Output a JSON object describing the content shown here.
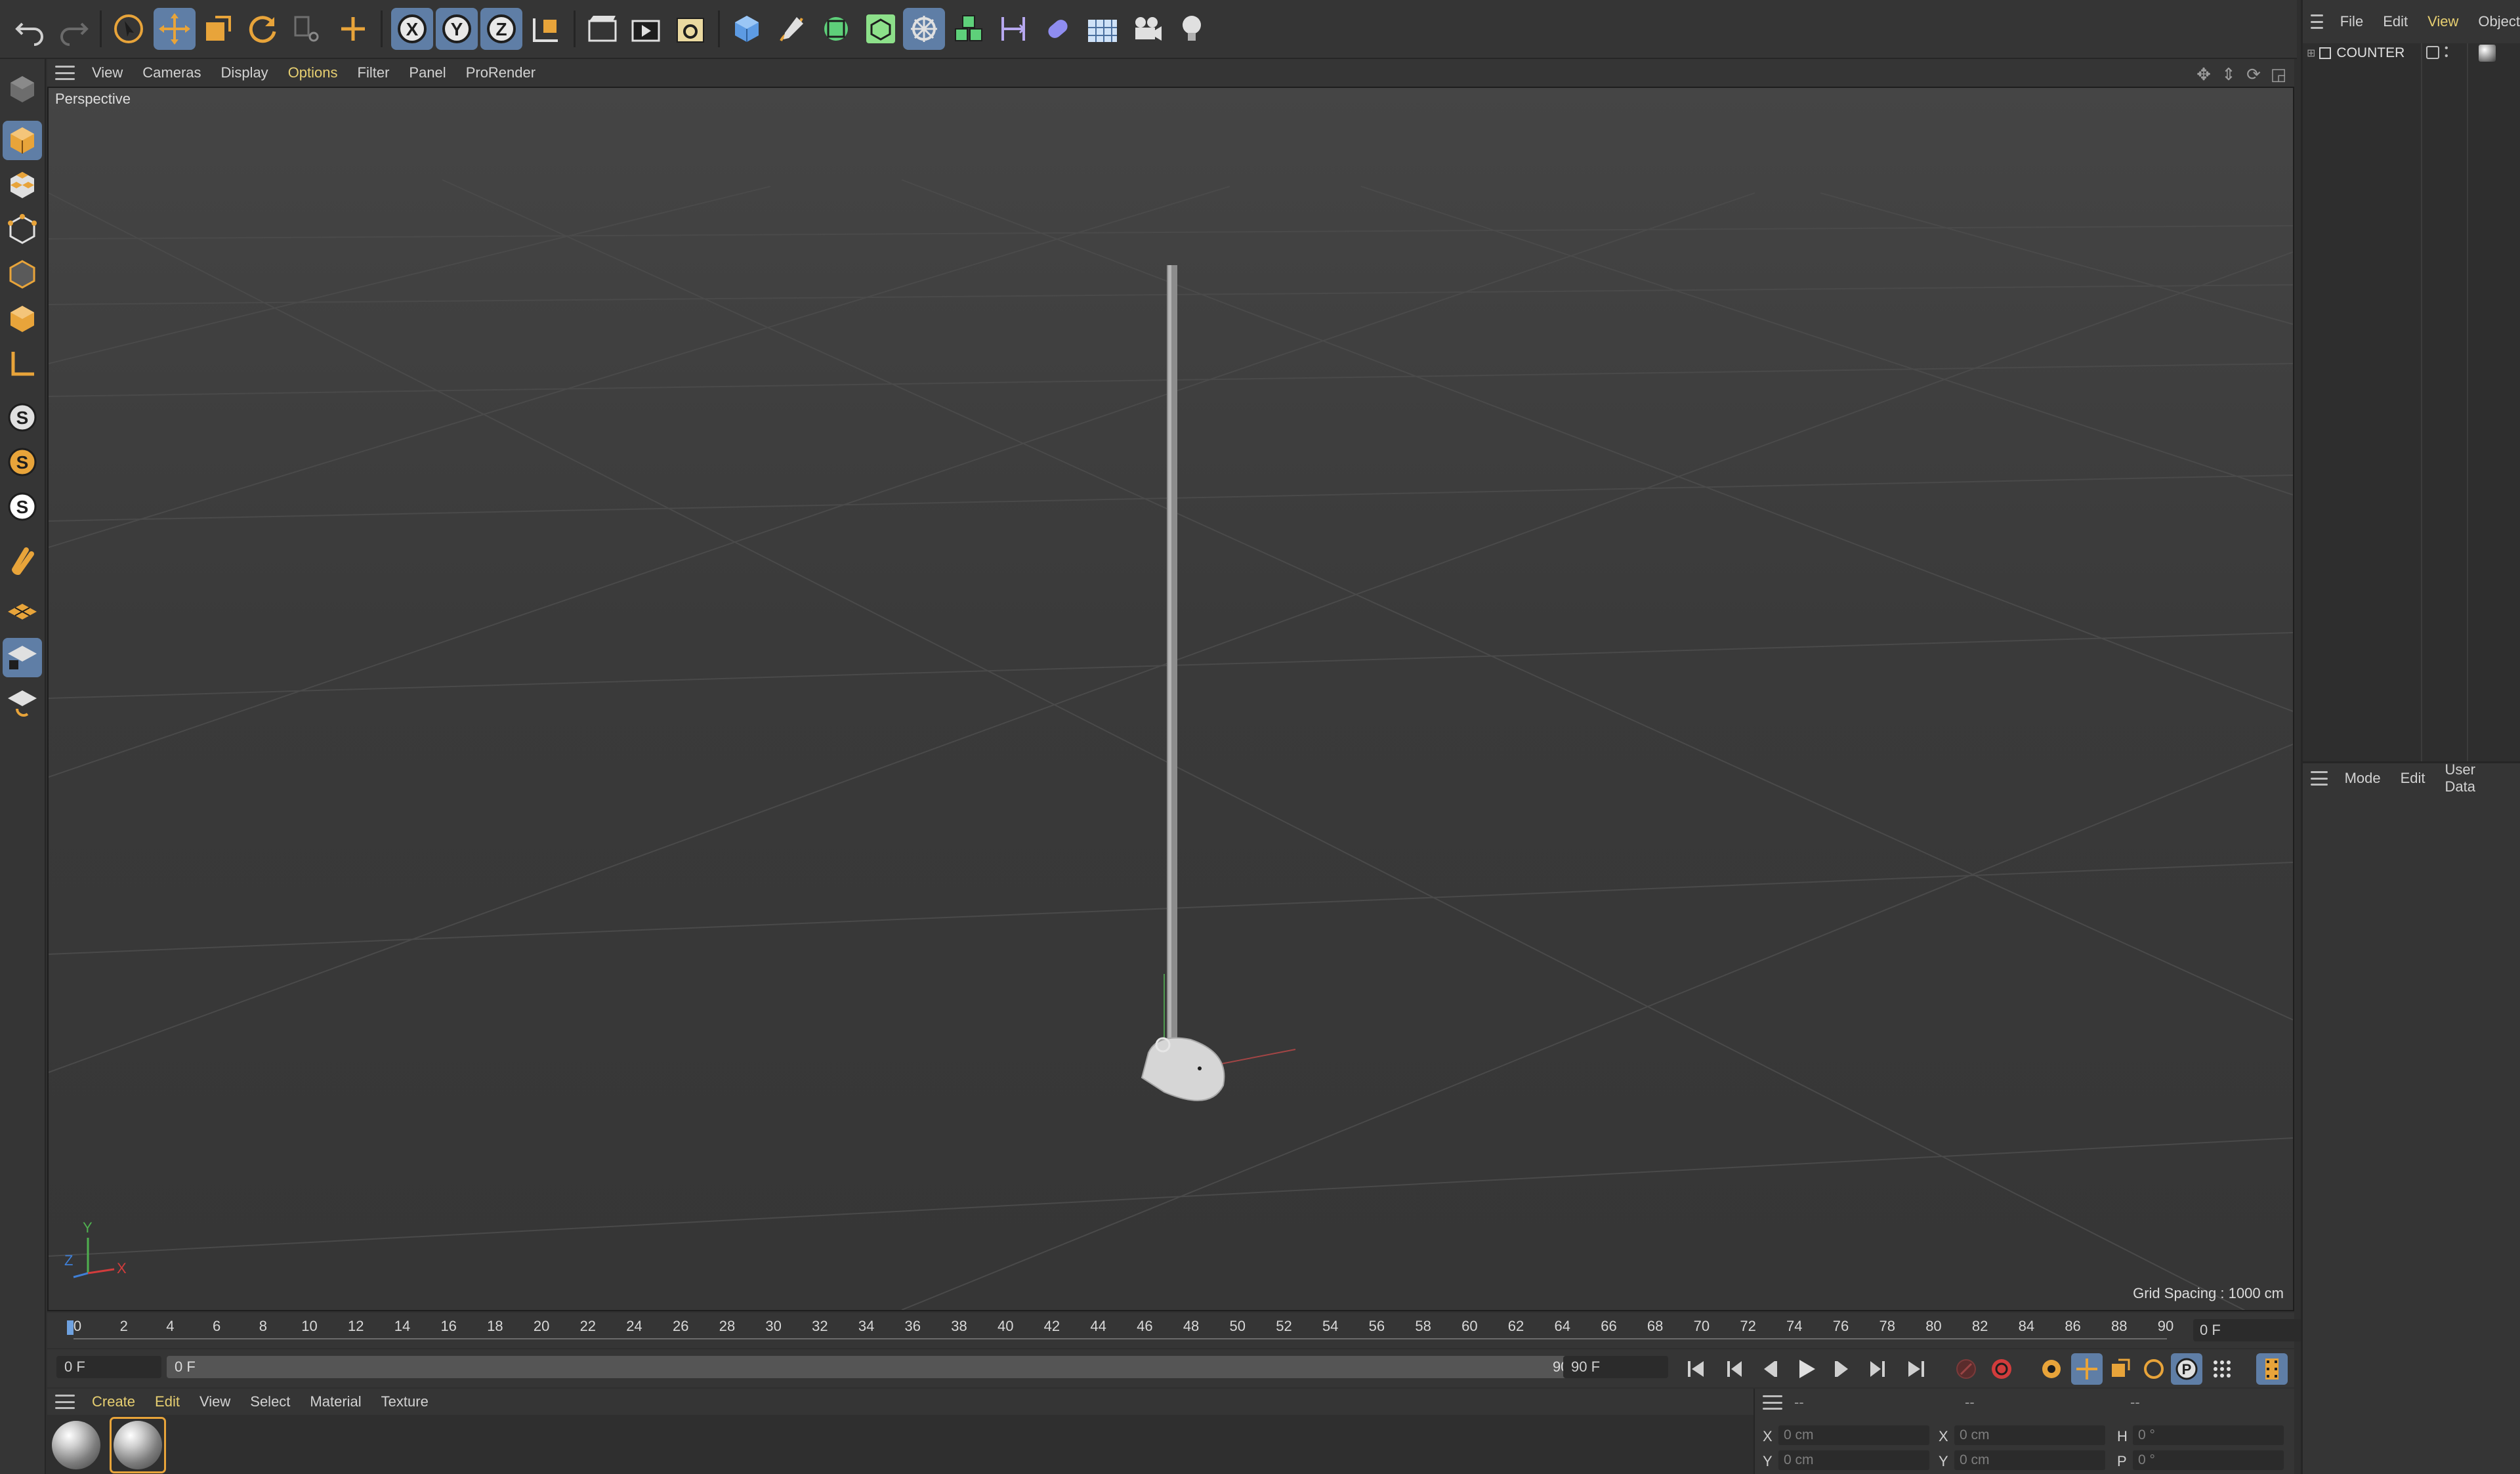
{
  "toolbar": {
    "axis_buttons": [
      "X",
      "Y",
      "Z"
    ]
  },
  "viewport": {
    "menu": [
      "View",
      "Cameras",
      "Display",
      "Options",
      "Filter",
      "Panel",
      "ProRender"
    ],
    "active_menu": "Options",
    "label": "Perspective",
    "grid_spacing": "Grid Spacing : 1000 cm",
    "axis_letters": {
      "x": "X",
      "y": "Y",
      "z": "Z"
    }
  },
  "timeline": {
    "ticks": [
      "0",
      "2",
      "4",
      "6",
      "8",
      "10",
      "12",
      "14",
      "16",
      "18",
      "20",
      "22",
      "24",
      "26",
      "28",
      "30",
      "32",
      "34",
      "36",
      "38",
      "40",
      "42",
      "44",
      "46",
      "48",
      "50",
      "52",
      "54",
      "56",
      "58",
      "60",
      "62",
      "64",
      "66",
      "68",
      "70",
      "72",
      "74",
      "76",
      "78",
      "80",
      "82",
      "84",
      "86",
      "88",
      "90"
    ],
    "current_frame": "0 F"
  },
  "transport": {
    "start_field": "0 F",
    "slider_start": "0 F",
    "slider_end": "90 F",
    "end_field": "90 F"
  },
  "material_manager": {
    "menu": [
      "Create",
      "Edit",
      "View",
      "Select",
      "Material",
      "Texture"
    ],
    "highlight": [
      "Create",
      "Edit"
    ],
    "materials": 2
  },
  "coordinates": {
    "headers": [
      "--",
      "--",
      "--"
    ],
    "rows": [
      {
        "a_label": "X",
        "a_value": "0 cm",
        "b_label": "X",
        "b_value": "0 cm",
        "c_label": "H",
        "c_value": "0 °"
      },
      {
        "a_label": "Y",
        "a_value": "0 cm",
        "b_label": "Y",
        "b_value": "0 cm",
        "c_label": "P",
        "c_value": "0 °"
      }
    ]
  },
  "object_manager": {
    "menu": [
      "File",
      "Edit",
      "View",
      "Object"
    ],
    "active_menu": "View",
    "objects": [
      {
        "name": "COUNTER"
      }
    ]
  },
  "attribute_manager": {
    "menu": [
      "Mode",
      "Edit",
      "User Data"
    ]
  },
  "colors": {
    "accent_blue": "#5f7ea6",
    "highlight_yellow": "#e7cf71",
    "orange": "#e8a43a",
    "x_axis": "#d23c3c",
    "y_axis": "#4fb04f",
    "z_axis": "#3f7fd6"
  }
}
